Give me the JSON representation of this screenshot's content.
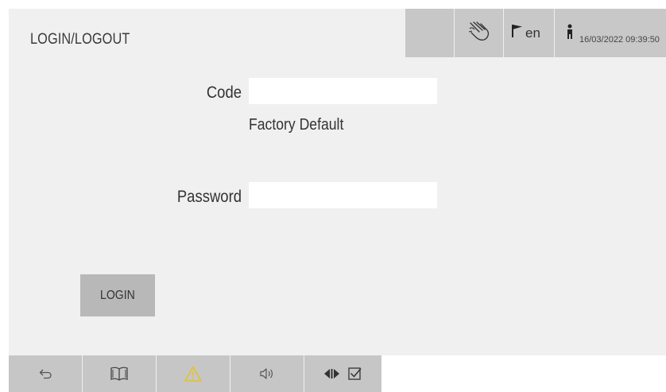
{
  "header": {
    "title": "LOGIN/LOGOUT",
    "language": "en",
    "datetime": "16/03/2022 09:39:50",
    "icons": [
      "hand-icon",
      "flag-icon",
      "user-icon"
    ]
  },
  "form": {
    "code_label": "Code",
    "code_value": "",
    "code_hint": "Factory Default",
    "password_label": "Password",
    "password_value": ""
  },
  "actions": {
    "login_label": "LOGIN"
  },
  "toolbar": {
    "buttons": [
      {
        "name": "back-arrow-icon"
      },
      {
        "name": "manual-book-icon"
      },
      {
        "name": "warning-icon",
        "color": "#e8c21a"
      },
      {
        "name": "speaker-icon"
      },
      {
        "name": "play-pause-check-icon"
      }
    ]
  },
  "colors": {
    "panel": "#f0f0f0",
    "header_box": "#c8c8c8",
    "button": "#b8b8b8",
    "toolbar": "#c6c6c6",
    "warning": "#e8c21a"
  }
}
